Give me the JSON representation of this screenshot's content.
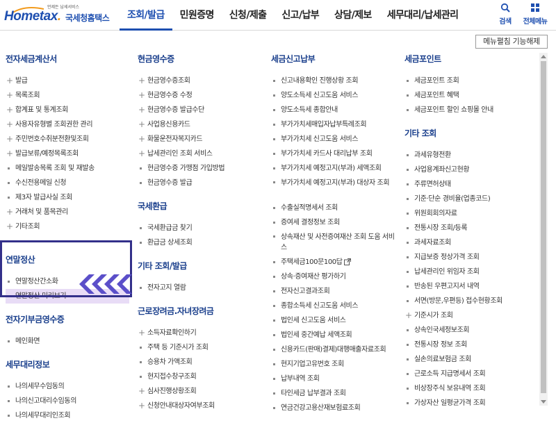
{
  "header": {
    "logo_tagline": "언제든 납세서비스",
    "logo_brand_a": "Home",
    "logo_brand_b": "tax",
    "logo_brand_c": ".",
    "logo_korean": "국세청홈택스",
    "nav": [
      {
        "label": "조회/발급",
        "active": true
      },
      {
        "label": "민원증명",
        "active": false
      },
      {
        "label": "신청/제출",
        "active": false
      },
      {
        "label": "신고/납부",
        "active": false
      },
      {
        "label": "상담/제보",
        "active": false
      },
      {
        "label": "세무대리/납세관리",
        "active": false
      }
    ],
    "search_label": "검색",
    "all_menu_label": "전체메뉴",
    "menu_toggle_label": "메뉴펼침 기능해제"
  },
  "columns": [
    {
      "sections": [
        {
          "title": "전자세금계산서",
          "items": [
            {
              "label": "발급",
              "plus": true
            },
            {
              "label": "목록조회",
              "plus": true
            },
            {
              "label": "합계표 및 통계조회",
              "plus": true
            },
            {
              "label": "사용자유형별 조회권한 관리",
              "plus": true
            },
            {
              "label": "주민번호수취분전환및조회",
              "plus": true
            },
            {
              "label": "발급보류/예정목록조회",
              "plus": true
            },
            {
              "label": "메일발송목록 조회 및 재발송",
              "plus": false
            },
            {
              "label": "수신전용메일 신청",
              "plus": false
            },
            {
              "label": "제3자 발급사실 조회",
              "plus": false
            },
            {
              "label": "거래처 및 품목관리",
              "plus": true
            },
            {
              "label": "기타조회",
              "plus": true
            }
          ]
        },
        {
          "title": "연말정산",
          "items": [
            {
              "label": "연말정산간소화",
              "plus": false
            },
            {
              "label": "연말정산 미리보기",
              "plus": false,
              "highlight": true
            }
          ]
        },
        {
          "title": "전자기부금영수증",
          "items": [
            {
              "label": "메인화면",
              "plus": false
            }
          ]
        },
        {
          "title": "세무대리정보",
          "items": [
            {
              "label": "나의세무수임동의",
              "plus": false
            },
            {
              "label": "나의신고대리수임동의",
              "plus": false
            },
            {
              "label": "나의세무대리인조회",
              "plus": false
            }
          ]
        }
      ]
    },
    {
      "sections": [
        {
          "title": "현금영수증",
          "items": [
            {
              "label": "현금영수증조회",
              "plus": true
            },
            {
              "label": "현금영수증 수정",
              "plus": true
            },
            {
              "label": "현금영수증 발급수단",
              "plus": true
            },
            {
              "label": "사업용신용카드",
              "plus": true
            },
            {
              "label": "화물운전자복지카드",
              "plus": true
            },
            {
              "label": "납세관리인 조회 서비스",
              "plus": true
            },
            {
              "label": "현금영수증 가맹점 가입방법",
              "plus": false
            },
            {
              "label": "현금영수증 발급",
              "plus": false
            }
          ]
        },
        {
          "title": "국세환급",
          "items": [
            {
              "label": "국세환급금 찾기",
              "plus": false
            },
            {
              "label": "환급금 상세조회",
              "plus": false
            }
          ]
        },
        {
          "title": "기타 조회/발급",
          "items": [
            {
              "label": "전자고지 열람",
              "plus": false
            }
          ]
        },
        {
          "title": "근로장려금.자녀장려금",
          "items": [
            {
              "label": "소득자료확인하기",
              "plus": true
            },
            {
              "label": "주택 등 기준시가 조회",
              "plus": false
            },
            {
              "label": "승용차 가액조회",
              "plus": false
            },
            {
              "label": "현지접수창구조회",
              "plus": false
            },
            {
              "label": "심사진행상황조회",
              "plus": true
            },
            {
              "label": "신청안내대상자여부조회",
              "plus": true
            }
          ]
        }
      ]
    },
    {
      "sections": [
        {
          "title": "세금신고납부",
          "items": [
            {
              "label": "신고내용확인 진행상황 조회",
              "plus": false
            },
            {
              "label": "양도소득세 신고도움 서비스",
              "plus": false
            },
            {
              "label": "양도소득세 종합안내",
              "plus": false
            },
            {
              "label": "부가가치세매입자납부특례조회",
              "plus": false
            },
            {
              "label": "부가가치세 신고도움 서비스",
              "plus": false
            },
            {
              "label": "부가가치세 카드사 대리납부 조회",
              "plus": false
            },
            {
              "label": "부가가치세 예정고지(부과) 세액조회",
              "plus": false
            },
            {
              "label": "부가가치세 예정고지(부과) 대상자 조회",
              "plus": false,
              "tall": true
            },
            {
              "label": "수출실적명세서 조회",
              "plus": false
            },
            {
              "label": "증여세 결정정보 조회",
              "plus": false
            },
            {
              "label": "상속재산 및 사전증여재산 조회 도움 서비스",
              "plus": false,
              "tall": true
            },
            {
              "label": "주택세금100문100답",
              "plus": false,
              "external": true
            },
            {
              "label": "상속·증여재산 평가하기",
              "plus": false
            },
            {
              "label": "전자신고결과조회",
              "plus": false
            },
            {
              "label": "종합소득세 신고도움 서비스",
              "plus": false
            },
            {
              "label": "법인세 신고도움 서비스",
              "plus": false
            },
            {
              "label": "법인세 중간예납 세액조회",
              "plus": false
            },
            {
              "label": "신용카드(판매)결제)대행매출자료조회",
              "plus": false
            },
            {
              "label": "현지기업고유번호 조회",
              "plus": false
            },
            {
              "label": "납부내역 조회",
              "plus": false
            },
            {
              "label": "타인세금 납부결과 조회",
              "plus": false
            },
            {
              "label": "연금건강고용산재보험료조회",
              "plus": false
            }
          ]
        }
      ]
    },
    {
      "sections": [
        {
          "title": "세금포인트",
          "items": [
            {
              "label": "세금포인트 조회",
              "plus": false
            },
            {
              "label": "세금포인트 혜택",
              "plus": false
            },
            {
              "label": "세금포인트 할인 쇼핑몰 안내",
              "plus": false
            }
          ]
        },
        {
          "title": "기타 조회",
          "items": [
            {
              "label": "과세유형전환",
              "plus": false
            },
            {
              "label": "사업용계좌신고현황",
              "plus": false
            },
            {
              "label": "주류면허상태",
              "plus": false
            },
            {
              "label": "기준·단순 경비율(업종코드)",
              "plus": false
            },
            {
              "label": "위원회회의자료",
              "plus": false
            },
            {
              "label": "전통시장 조회/등록",
              "plus": false
            },
            {
              "label": "과세자료조회",
              "plus": false
            },
            {
              "label": "지급보증 정상가격 조회",
              "plus": false
            },
            {
              "label": "납세관리인 위임자 조회",
              "plus": false
            },
            {
              "label": "반송된 우편고지서 내역",
              "plus": false
            },
            {
              "label": "서면(방문,우편등) 접수현황조회",
              "plus": false
            },
            {
              "label": "기준시가 조회",
              "plus": true
            },
            {
              "label": "상속인국세정보조회",
              "plus": false
            },
            {
              "label": "전통시장 정보 조회",
              "plus": false
            },
            {
              "label": "실손의료보험금 조회",
              "plus": false
            },
            {
              "label": "근로소득 지급명세서 조회",
              "plus": false
            },
            {
              "label": "비상장주식 보유내역 조회",
              "plus": false
            },
            {
              "label": "가상자산 일평균가격 조회",
              "plus": false
            }
          ]
        }
      ]
    }
  ]
}
